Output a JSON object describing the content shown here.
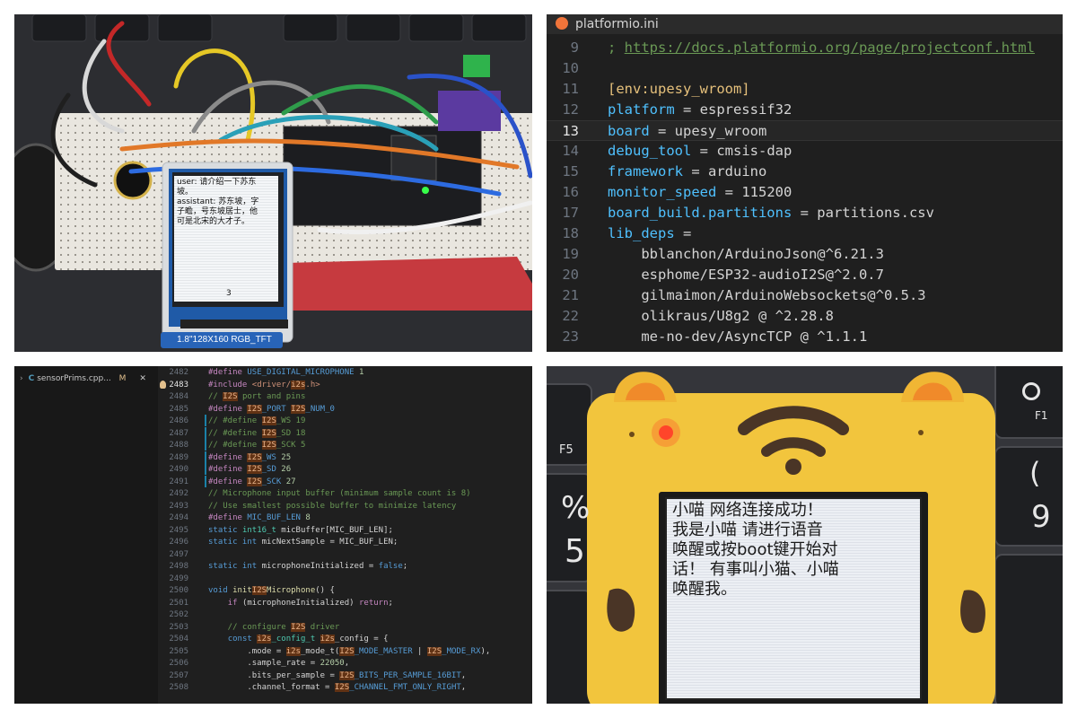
{
  "photo1": {
    "screen_lines": [
      "user: 请介绍一下苏东",
      "坡。",
      "assistant: 苏东坡，字",
      "子瞻，号东坡居士，他",
      "可是北宋的大才子。"
    ],
    "screen_footer": "3",
    "module_label": "1.8\"128X160 RGB_TFT"
  },
  "ini": {
    "tab_title": "platformio.ini",
    "lines": [
      {
        "n": "9",
        "parts": [
          [
            "cm",
            "; "
          ],
          [
            "url",
            "https://docs.platformio.org/page/projectconf.html"
          ]
        ]
      },
      {
        "n": "10",
        "parts": []
      },
      {
        "n": "11",
        "parts": [
          [
            "sec",
            "[env:upesy_wroom]"
          ]
        ]
      },
      {
        "n": "12",
        "parts": [
          [
            "k",
            "platform"
          ],
          [
            "w",
            " = espressif32"
          ]
        ]
      },
      {
        "n": "13",
        "current": true,
        "parts": [
          [
            "k",
            "board"
          ],
          [
            "w",
            " = upesy_wroom"
          ]
        ]
      },
      {
        "n": "14",
        "parts": [
          [
            "k",
            "debug_tool"
          ],
          [
            "w",
            " = cmsis-dap"
          ]
        ]
      },
      {
        "n": "15",
        "parts": [
          [
            "k",
            "framework"
          ],
          [
            "w",
            " = arduino"
          ]
        ]
      },
      {
        "n": "16",
        "parts": [
          [
            "k",
            "monitor_speed"
          ],
          [
            "w",
            " = 115200"
          ]
        ]
      },
      {
        "n": "17",
        "parts": [
          [
            "k",
            "board_build.partitions"
          ],
          [
            "w",
            " = partitions.csv"
          ]
        ]
      },
      {
        "n": "18",
        "parts": [
          [
            "k",
            "lib_deps"
          ],
          [
            "w",
            " ="
          ]
        ]
      },
      {
        "n": "19",
        "parts": [
          [
            "w",
            "    bblanchon/ArduinoJson@^6.21.3"
          ]
        ]
      },
      {
        "n": "20",
        "parts": [
          [
            "w",
            "    esphome/ESP32-audioI2S@^2.0.7"
          ]
        ]
      },
      {
        "n": "21",
        "parts": [
          [
            "w",
            "    gilmaimon/ArduinoWebsockets@^0.5.3"
          ]
        ]
      },
      {
        "n": "22",
        "parts": [
          [
            "w",
            "    olikraus/U8g2 @ ^2.28.8"
          ]
        ]
      },
      {
        "n": "23",
        "parts": [
          [
            "w",
            "    me-no-dev/AsyncTCP @ ^1.1.1"
          ]
        ]
      }
    ]
  },
  "code": {
    "file_tab": "sensorPrims.cpp...",
    "file_tab_badge": "M",
    "lines": [
      {
        "n": "2482",
        "parts": [
          [
            "pp",
            "#define "
          ],
          [
            "kw",
            "USE_DIGITAL_MICROPHONE"
          ],
          [
            "num",
            " 1"
          ]
        ]
      },
      {
        "n": "2483",
        "active": true,
        "parts": [
          [
            "pp",
            "#include "
          ],
          [
            "str",
            "<driver/"
          ],
          [
            "hl",
            "i2s"
          ],
          [
            "str",
            ".h>"
          ]
        ]
      },
      {
        "n": "2484",
        "parts": [
          [
            "cmt",
            "// "
          ],
          [
            "hl",
            "I2S"
          ],
          [
            "cmt",
            " port and pins"
          ]
        ]
      },
      {
        "n": "2485",
        "parts": [
          [
            "pp",
            "#define "
          ],
          [
            "hl",
            "I2S"
          ],
          [
            "kw",
            "_PORT "
          ],
          [
            "hl",
            "I2S"
          ],
          [
            "kw",
            "_NUM_0"
          ]
        ]
      },
      {
        "n": "2486",
        "mod": true,
        "parts": [
          [
            "cmt",
            "// #define "
          ],
          [
            "hl",
            "I2S"
          ],
          [
            "cmt",
            "_WS 19"
          ]
        ]
      },
      {
        "n": "2487",
        "mod": true,
        "parts": [
          [
            "cmt",
            "// #define "
          ],
          [
            "hl",
            "I2S"
          ],
          [
            "cmt",
            "_SD 18"
          ]
        ]
      },
      {
        "n": "2488",
        "mod": true,
        "parts": [
          [
            "cmt",
            "// #define "
          ],
          [
            "hl",
            "I2S"
          ],
          [
            "cmt",
            "_SCK 5"
          ]
        ]
      },
      {
        "n": "2489",
        "mod": true,
        "parts": [
          [
            "pp",
            "#define "
          ],
          [
            "hl",
            "I2S"
          ],
          [
            "kw",
            "_WS"
          ],
          [
            "num",
            " 25"
          ]
        ]
      },
      {
        "n": "2490",
        "mod": true,
        "parts": [
          [
            "pp",
            "#define "
          ],
          [
            "hl",
            "I2S"
          ],
          [
            "kw",
            "_SD"
          ],
          [
            "num",
            " 26"
          ]
        ]
      },
      {
        "n": "2491",
        "mod": true,
        "parts": [
          [
            "pp",
            "#define "
          ],
          [
            "hl",
            "I2S"
          ],
          [
            "kw",
            "_SCK"
          ],
          [
            "num",
            " 27"
          ]
        ]
      },
      {
        "n": "2492",
        "parts": [
          [
            "cmt",
            "// Microphone input buffer (minimum sample count is 8)"
          ]
        ]
      },
      {
        "n": "2493",
        "parts": [
          [
            "cmt",
            "// Use smallest possible buffer to minimize latency"
          ]
        ]
      },
      {
        "n": "2494",
        "parts": [
          [
            "pp",
            "#define "
          ],
          [
            "kw",
            "MIC_BUF_LEN"
          ],
          [
            "num",
            " 8"
          ]
        ]
      },
      {
        "n": "2495",
        "parts": [
          [
            "kw",
            "static "
          ],
          [
            "ty",
            "int16_t "
          ],
          [
            "wt",
            "micBuffer[MIC_BUF_LEN];"
          ]
        ]
      },
      {
        "n": "2496",
        "parts": [
          [
            "kw",
            "static int "
          ],
          [
            "wt",
            "micNextSample = MIC_BUF_LEN;"
          ]
        ]
      },
      {
        "n": "2497",
        "parts": []
      },
      {
        "n": "2498",
        "parts": [
          [
            "kw",
            "static int "
          ],
          [
            "wt",
            "microphoneInitialized = "
          ],
          [
            "kw",
            "false"
          ],
          [
            "wt",
            ";"
          ]
        ]
      },
      {
        "n": "2499",
        "parts": []
      },
      {
        "n": "2500",
        "parts": [
          [
            "kw",
            "void "
          ],
          [
            "fn",
            "init"
          ],
          [
            "hl",
            "I2S"
          ],
          [
            "fn",
            "Microphone"
          ],
          [
            "wt",
            "() {"
          ]
        ]
      },
      {
        "n": "2501",
        "parts": [
          [
            "wt",
            "    "
          ],
          [
            "pp",
            "if "
          ],
          [
            "wt",
            "(microphoneInitialized) "
          ],
          [
            "pp",
            "return"
          ],
          [
            "wt",
            ";"
          ]
        ]
      },
      {
        "n": "2502",
        "parts": []
      },
      {
        "n": "2503",
        "parts": [
          [
            "cmt",
            "    // configure "
          ],
          [
            "hl",
            "I2S"
          ],
          [
            "cmt",
            " driver"
          ]
        ]
      },
      {
        "n": "2504",
        "parts": [
          [
            "wt",
            "    "
          ],
          [
            "kw",
            "const "
          ],
          [
            "hl",
            "i2s"
          ],
          [
            "ty",
            "_config_t "
          ],
          [
            "hl",
            "i2s"
          ],
          [
            "wt",
            "_config = {"
          ]
        ]
      },
      {
        "n": "2505",
        "parts": [
          [
            "wt",
            "        .mode = "
          ],
          [
            "hl",
            "i2s"
          ],
          [
            "wt",
            "_mode_t("
          ],
          [
            "hl",
            "I2S"
          ],
          [
            "kw",
            "_MODE_MASTER"
          ],
          [
            "wt",
            " | "
          ],
          [
            "hl",
            "I2S"
          ],
          [
            "kw",
            "_MODE_RX"
          ],
          [
            "wt",
            "),"
          ]
        ]
      },
      {
        "n": "2506",
        "parts": [
          [
            "wt",
            "        .sample_rate = "
          ],
          [
            "num",
            "22050"
          ],
          [
            "wt",
            ","
          ]
        ]
      },
      {
        "n": "2507",
        "parts": [
          [
            "wt",
            "        .bits_per_sample = "
          ],
          [
            "hl",
            "I2S"
          ],
          [
            "kw",
            "_BITS_PER_SAMPLE_16BIT"
          ],
          [
            "wt",
            ","
          ]
        ]
      },
      {
        "n": "2508",
        "parts": [
          [
            "wt",
            "        .channel_format = "
          ],
          [
            "hl",
            "I2S"
          ],
          [
            "kw",
            "_CHANNEL_FMT_ONLY_RIGHT"
          ],
          [
            "wt",
            ","
          ]
        ]
      }
    ]
  },
  "photo2": {
    "screen_lines": [
      "小喵  网络连接成功！",
      "我是小喵  请进行语音",
      "唤醒或按boot键开始对",
      "话！ 有事叫小猫、小喵",
      "唤醒我。"
    ],
    "key_labels": [
      "F5",
      "%",
      "5",
      "F1",
      "(",
      "9"
    ]
  },
  "colors": {
    "editor_bg": "#1f1f1f",
    "ini_key": "#4fc1ff",
    "comment": "#6a9955",
    "search_highlight": "#613214"
  }
}
